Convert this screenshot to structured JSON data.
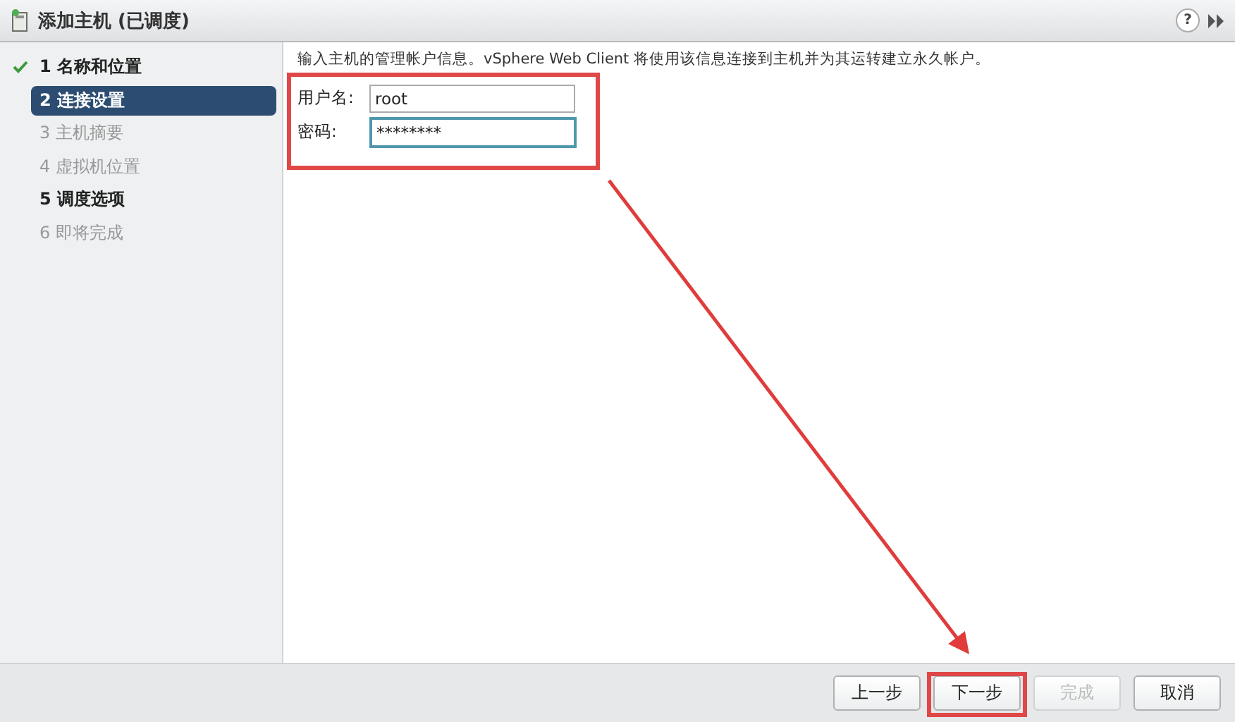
{
  "window": {
    "title": "添加主机 (已调度)",
    "help": "?"
  },
  "steps": [
    {
      "number": "1",
      "label": "名称和位置",
      "completed": true,
      "selected": false,
      "disabled": false
    },
    {
      "number": "2",
      "label": "连接设置",
      "completed": false,
      "selected": true,
      "disabled": false
    },
    {
      "number": "3",
      "label": "主机摘要",
      "completed": false,
      "selected": false,
      "disabled": true
    },
    {
      "number": "4",
      "label": "虚拟机位置",
      "completed": false,
      "selected": false,
      "disabled": true
    },
    {
      "number": "5",
      "label": "调度选项",
      "completed": false,
      "selected": false,
      "disabled": false
    },
    {
      "number": "6",
      "label": "即将完成",
      "completed": false,
      "selected": false,
      "disabled": true
    }
  ],
  "instruction": "输入主机的管理帐户信息。vSphere Web Client 将使用该信息连接到主机并为其运转建立永久帐户。",
  "fields": [
    {
      "label": "用户名:",
      "value": "root",
      "focused": false
    },
    {
      "label": "密码:",
      "value": "********",
      "focused": true
    }
  ],
  "buttons": [
    {
      "label": "上一步",
      "disabled": false
    },
    {
      "label": "下一步",
      "disabled": false
    },
    {
      "label": "完成",
      "disabled": true
    },
    {
      "label": "取消",
      "disabled": false
    }
  ]
}
